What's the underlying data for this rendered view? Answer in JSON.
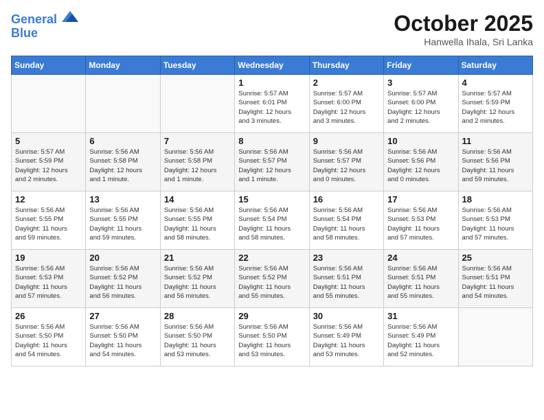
{
  "header": {
    "logo_line1": "General",
    "logo_line2": "Blue",
    "month": "October 2025",
    "location": "Hanwella Ihala, Sri Lanka"
  },
  "weekdays": [
    "Sunday",
    "Monday",
    "Tuesday",
    "Wednesday",
    "Thursday",
    "Friday",
    "Saturday"
  ],
  "weeks": [
    [
      {
        "day": "",
        "empty": true
      },
      {
        "day": "",
        "empty": true
      },
      {
        "day": "",
        "empty": true
      },
      {
        "day": "1",
        "line1": "Sunrise: 5:57 AM",
        "line2": "Sunset: 6:01 PM",
        "line3": "Daylight: 12 hours",
        "line4": "and 3 minutes."
      },
      {
        "day": "2",
        "line1": "Sunrise: 5:57 AM",
        "line2": "Sunset: 6:00 PM",
        "line3": "Daylight: 12 hours",
        "line4": "and 3 minutes."
      },
      {
        "day": "3",
        "line1": "Sunrise: 5:57 AM",
        "line2": "Sunset: 6:00 PM",
        "line3": "Daylight: 12 hours",
        "line4": "and 2 minutes."
      },
      {
        "day": "4",
        "line1": "Sunrise: 5:57 AM",
        "line2": "Sunset: 5:59 PM",
        "line3": "Daylight: 12 hours",
        "line4": "and 2 minutes."
      }
    ],
    [
      {
        "day": "5",
        "line1": "Sunrise: 5:57 AM",
        "line2": "Sunset: 5:59 PM",
        "line3": "Daylight: 12 hours",
        "line4": "and 2 minutes."
      },
      {
        "day": "6",
        "line1": "Sunrise: 5:56 AM",
        "line2": "Sunset: 5:58 PM",
        "line3": "Daylight: 12 hours",
        "line4": "and 1 minute."
      },
      {
        "day": "7",
        "line1": "Sunrise: 5:56 AM",
        "line2": "Sunset: 5:58 PM",
        "line3": "Daylight: 12 hours",
        "line4": "and 1 minute."
      },
      {
        "day": "8",
        "line1": "Sunrise: 5:56 AM",
        "line2": "Sunset: 5:57 PM",
        "line3": "Daylight: 12 hours",
        "line4": "and 1 minute."
      },
      {
        "day": "9",
        "line1": "Sunrise: 5:56 AM",
        "line2": "Sunset: 5:57 PM",
        "line3": "Daylight: 12 hours",
        "line4": "and 0 minutes."
      },
      {
        "day": "10",
        "line1": "Sunrise: 5:56 AM",
        "line2": "Sunset: 5:56 PM",
        "line3": "Daylight: 12 hours",
        "line4": "and 0 minutes."
      },
      {
        "day": "11",
        "line1": "Sunrise: 5:56 AM",
        "line2": "Sunset: 5:56 PM",
        "line3": "Daylight: 11 hours",
        "line4": "and 59 minutes."
      }
    ],
    [
      {
        "day": "12",
        "line1": "Sunrise: 5:56 AM",
        "line2": "Sunset: 5:55 PM",
        "line3": "Daylight: 11 hours",
        "line4": "and 59 minutes."
      },
      {
        "day": "13",
        "line1": "Sunrise: 5:56 AM",
        "line2": "Sunset: 5:55 PM",
        "line3": "Daylight: 11 hours",
        "line4": "and 59 minutes."
      },
      {
        "day": "14",
        "line1": "Sunrise: 5:56 AM",
        "line2": "Sunset: 5:55 PM",
        "line3": "Daylight: 11 hours",
        "line4": "and 58 minutes."
      },
      {
        "day": "15",
        "line1": "Sunrise: 5:56 AM",
        "line2": "Sunset: 5:54 PM",
        "line3": "Daylight: 11 hours",
        "line4": "and 58 minutes."
      },
      {
        "day": "16",
        "line1": "Sunrise: 5:56 AM",
        "line2": "Sunset: 5:54 PM",
        "line3": "Daylight: 11 hours",
        "line4": "and 58 minutes."
      },
      {
        "day": "17",
        "line1": "Sunrise: 5:56 AM",
        "line2": "Sunset: 5:53 PM",
        "line3": "Daylight: 11 hours",
        "line4": "and 57 minutes."
      },
      {
        "day": "18",
        "line1": "Sunrise: 5:56 AM",
        "line2": "Sunset: 5:53 PM",
        "line3": "Daylight: 11 hours",
        "line4": "and 57 minutes."
      }
    ],
    [
      {
        "day": "19",
        "line1": "Sunrise: 5:56 AM",
        "line2": "Sunset: 5:53 PM",
        "line3": "Daylight: 11 hours",
        "line4": "and 57 minutes."
      },
      {
        "day": "20",
        "line1": "Sunrise: 5:56 AM",
        "line2": "Sunset: 5:52 PM",
        "line3": "Daylight: 11 hours",
        "line4": "and 56 minutes."
      },
      {
        "day": "21",
        "line1": "Sunrise: 5:56 AM",
        "line2": "Sunset: 5:52 PM",
        "line3": "Daylight: 11 hours",
        "line4": "and 56 minutes."
      },
      {
        "day": "22",
        "line1": "Sunrise: 5:56 AM",
        "line2": "Sunset: 5:52 PM",
        "line3": "Daylight: 11 hours",
        "line4": "and 55 minutes."
      },
      {
        "day": "23",
        "line1": "Sunrise: 5:56 AM",
        "line2": "Sunset: 5:51 PM",
        "line3": "Daylight: 11 hours",
        "line4": "and 55 minutes."
      },
      {
        "day": "24",
        "line1": "Sunrise: 5:56 AM",
        "line2": "Sunset: 5:51 PM",
        "line3": "Daylight: 11 hours",
        "line4": "and 55 minutes."
      },
      {
        "day": "25",
        "line1": "Sunrise: 5:56 AM",
        "line2": "Sunset: 5:51 PM",
        "line3": "Daylight: 11 hours",
        "line4": "and 54 minutes."
      }
    ],
    [
      {
        "day": "26",
        "line1": "Sunrise: 5:56 AM",
        "line2": "Sunset: 5:50 PM",
        "line3": "Daylight: 11 hours",
        "line4": "and 54 minutes."
      },
      {
        "day": "27",
        "line1": "Sunrise: 5:56 AM",
        "line2": "Sunset: 5:50 PM",
        "line3": "Daylight: 11 hours",
        "line4": "and 54 minutes."
      },
      {
        "day": "28",
        "line1": "Sunrise: 5:56 AM",
        "line2": "Sunset: 5:50 PM",
        "line3": "Daylight: 11 hours",
        "line4": "and 53 minutes."
      },
      {
        "day": "29",
        "line1": "Sunrise: 5:56 AM",
        "line2": "Sunset: 5:50 PM",
        "line3": "Daylight: 11 hours",
        "line4": "and 53 minutes."
      },
      {
        "day": "30",
        "line1": "Sunrise: 5:56 AM",
        "line2": "Sunset: 5:49 PM",
        "line3": "Daylight: 11 hours",
        "line4": "and 53 minutes."
      },
      {
        "day": "31",
        "line1": "Sunrise: 5:56 AM",
        "line2": "Sunset: 5:49 PM",
        "line3": "Daylight: 11 hours",
        "line4": "and 52 minutes."
      },
      {
        "day": "",
        "empty": true
      }
    ]
  ]
}
